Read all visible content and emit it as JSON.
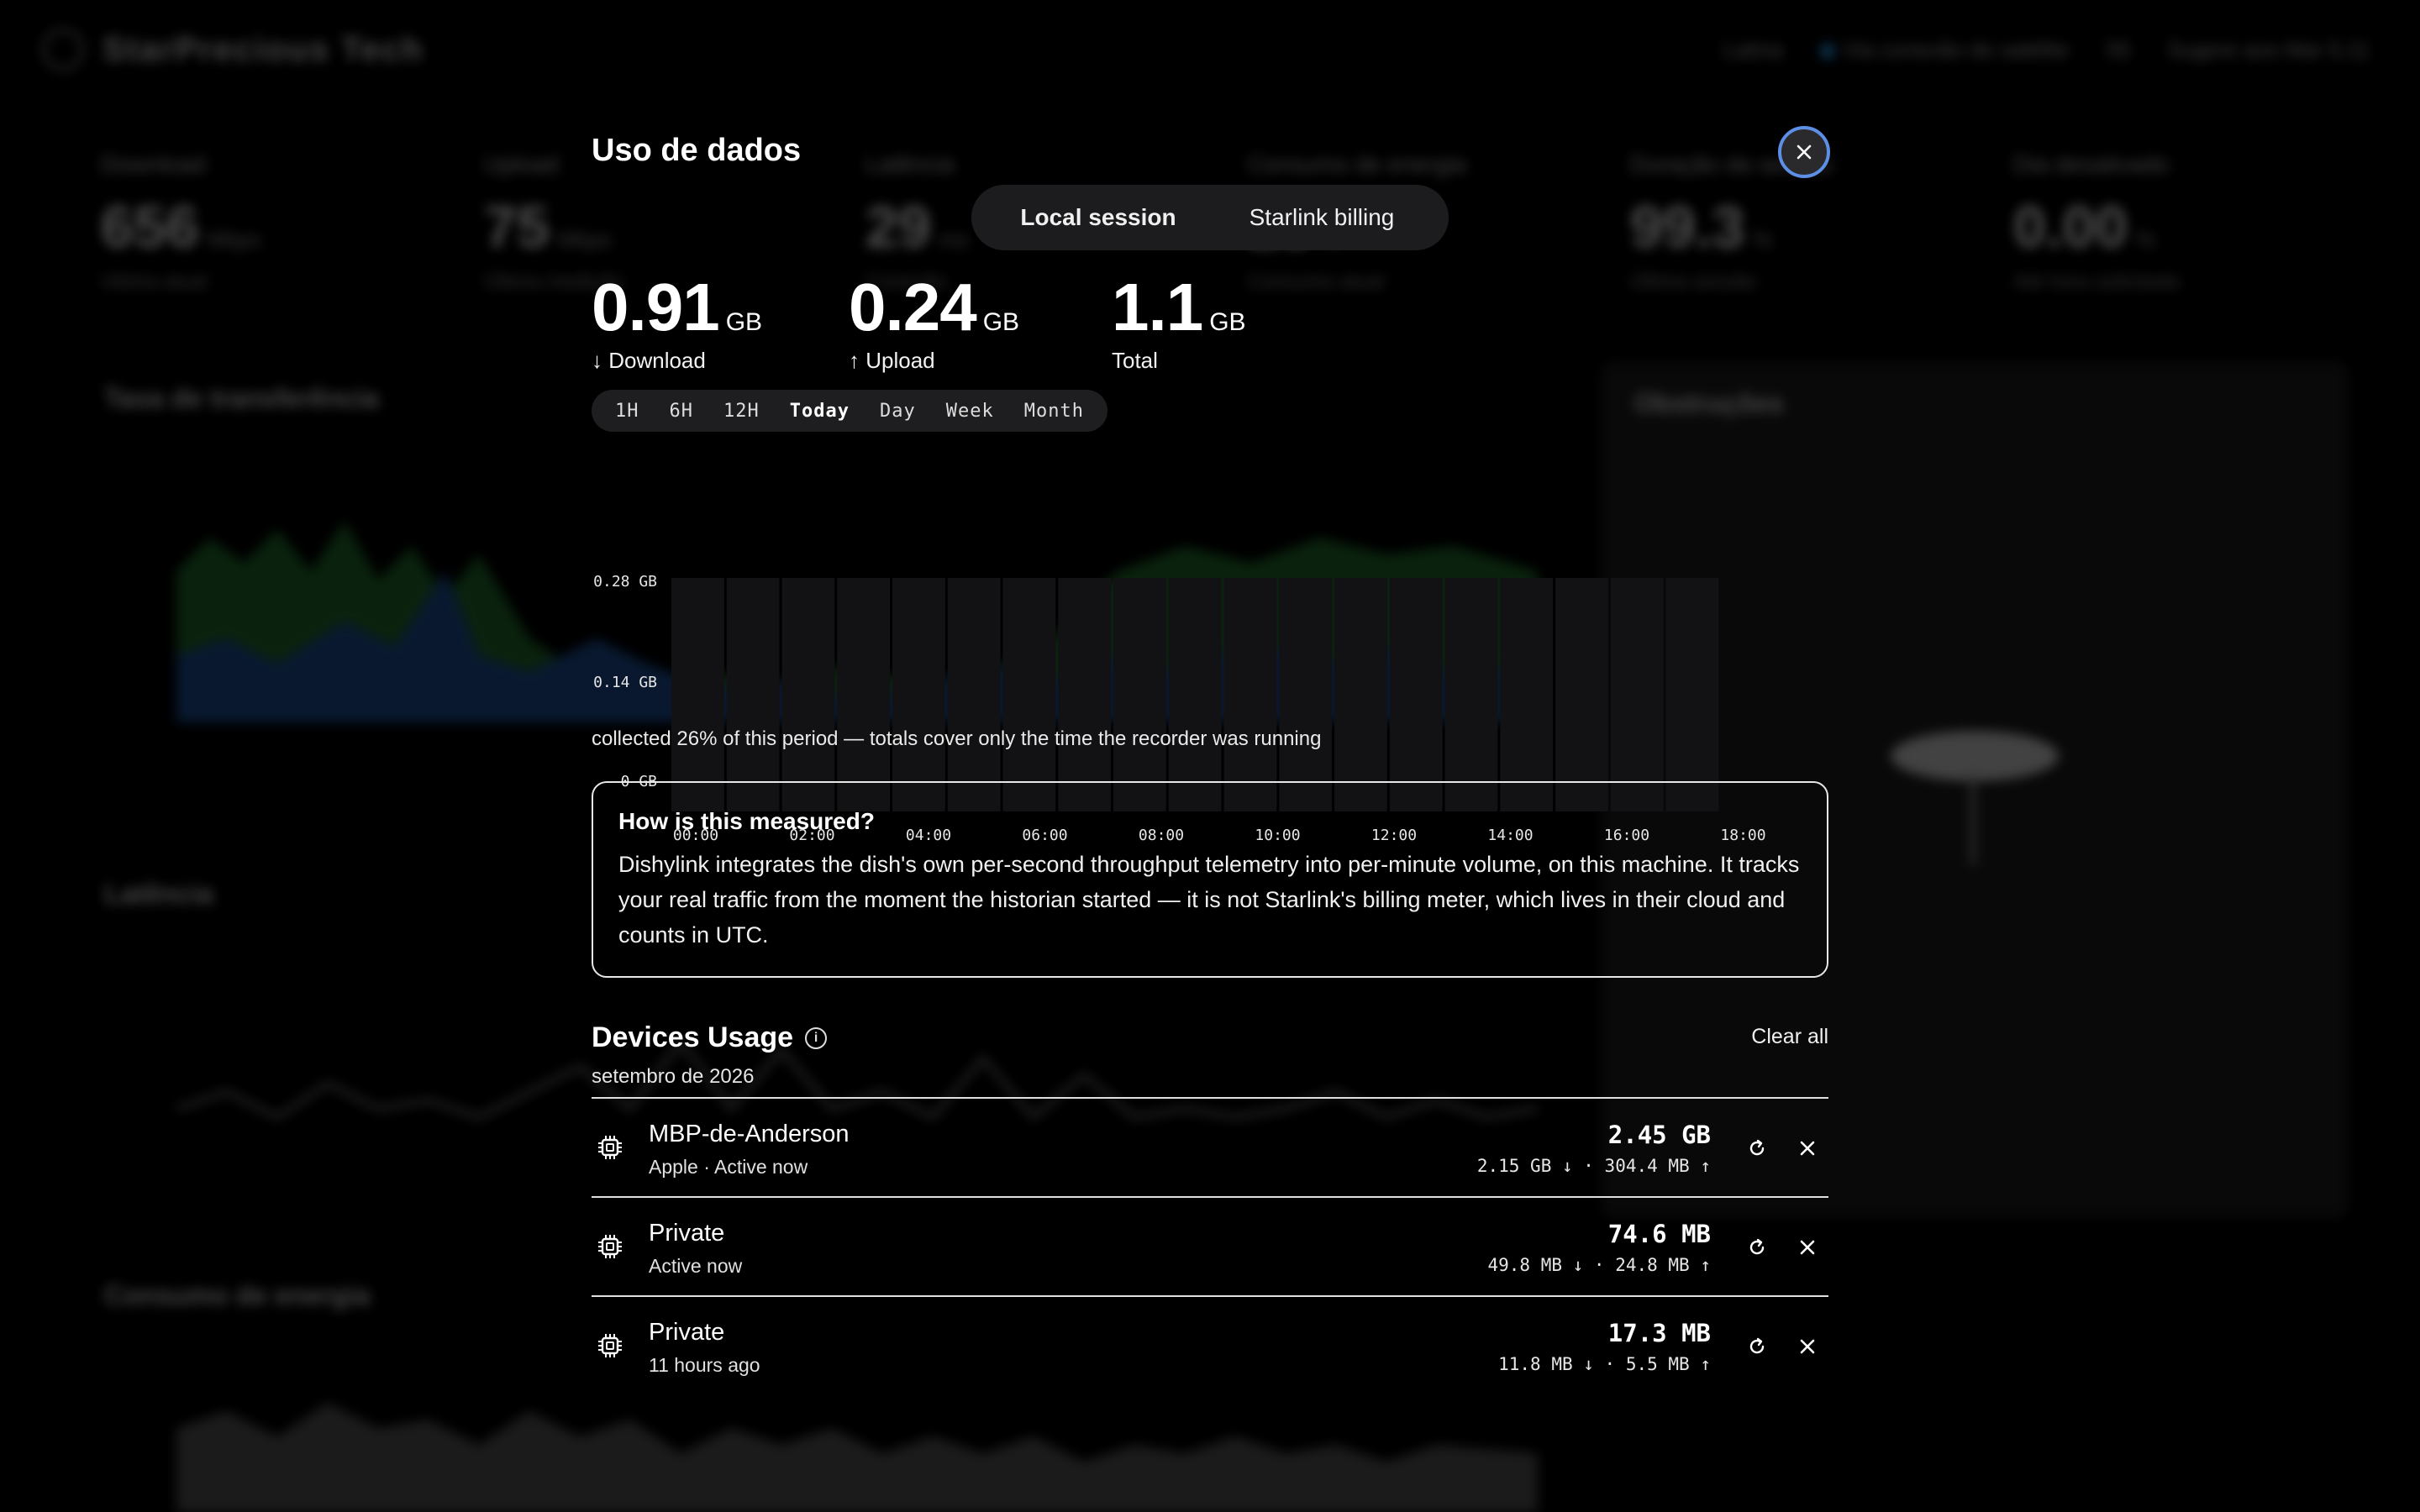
{
  "background": {
    "brand": "StarPrecious Tech",
    "nav": [
      "Latina",
      "Via conexão de satélite",
      "55",
      "Sugere aos Mar 5.11"
    ],
    "stats": [
      {
        "label": "Download",
        "value": "656",
        "unit": "Mbps",
        "sub": "Vitória atual"
      },
      {
        "label": "Upload",
        "value": "75",
        "unit": "Mbps",
        "sub": "Última medição"
      },
      {
        "label": "Latência",
        "value": "29",
        "unit": "ms",
        "sub": "Conexão"
      },
      {
        "label": "Consumo de energia",
        "value": "29",
        "unit": "W",
        "sub": "Consumo atual"
      },
      {
        "label": "Duração da sessão",
        "value": "99.3",
        "unit": "%",
        "sub": "Última sessão"
      },
      {
        "label": "Dia desativado",
        "value": "0.00",
        "unit": "%",
        "sub": "Até hora solicitada"
      }
    ],
    "panels": [
      "Taxa de transferência",
      "Latência",
      "Consumo de energia",
      "Obstruções"
    ]
  },
  "modal": {
    "title": "Uso de dados",
    "close_icon": "close-icon",
    "tabs": [
      {
        "label": "Local session",
        "active": true
      },
      {
        "label": "Starlink billing",
        "active": false
      }
    ],
    "totals": [
      {
        "value": "0.91",
        "unit": "GB",
        "caption": "↓ Download"
      },
      {
        "value": "0.24",
        "unit": "GB",
        "caption": "↑ Upload"
      },
      {
        "value": "1.1",
        "unit": "GB",
        "caption": "Total"
      }
    ],
    "ranges": [
      {
        "label": "1H",
        "active": false
      },
      {
        "label": "6H",
        "active": false
      },
      {
        "label": "12H",
        "active": false
      },
      {
        "label": "Today",
        "active": true
      },
      {
        "label": "Day",
        "active": false
      },
      {
        "label": "Week",
        "active": false
      },
      {
        "label": "Month",
        "active": false
      }
    ],
    "chart_data": {
      "type": "bar",
      "y_ticks": [
        "0.28 GB",
        "0.14 GB",
        "0 GB"
      ],
      "ylim": [
        0,
        0.28
      ],
      "x_ticks": [
        "00:00",
        "02:00",
        "04:00",
        "06:00",
        "08:00",
        "10:00",
        "12:00",
        "14:00",
        "16:00",
        "18:00"
      ],
      "categories": [
        "00:00",
        "01:00",
        "02:00",
        "03:00",
        "04:00",
        "05:00",
        "06:00",
        "07:00",
        "08:00",
        "09:00",
        "10:00",
        "11:00",
        "12:00",
        "13:00",
        "14:00",
        "15:00",
        "16:00",
        "17:00",
        "18:00"
      ],
      "series": [
        {
          "name": "Download",
          "values": [
            0,
            0,
            0,
            0,
            0,
            0,
            0,
            0,
            0,
            0,
            0,
            0,
            0,
            0,
            0,
            0,
            0,
            0,
            0
          ]
        },
        {
          "name": "Upload",
          "values": [
            0,
            0,
            0,
            0,
            0,
            0,
            0,
            0,
            0,
            0,
            0,
            0,
            0,
            0,
            0,
            0,
            0,
            0,
            0
          ]
        }
      ],
      "grid": true
    },
    "note": "collected 26% of this period — totals cover only the time the recorder was running",
    "info": {
      "heading": "How is this measured?",
      "body": "Dishylink integrates the dish's own per-second throughput telemetry into per-minute volume, on this machine. It tracks your real traffic from the moment the historian started — it is not Starlink's billing meter, which lives in their cloud and counts in UTC."
    },
    "devices": {
      "title": "Devices Usage",
      "month": "setembro de 2026",
      "clear_all": "Clear all",
      "items": [
        {
          "name": "MBP-de-Anderson",
          "meta": "Apple · Active now",
          "total": "2.45 GB",
          "split": "2.15 GB ↓ · 304.4 MB ↑"
        },
        {
          "name": "Private",
          "meta": "Active now",
          "total": "74.6 MB",
          "split": "49.8 MB ↓ · 24.8 MB ↑"
        },
        {
          "name": "Private",
          "meta": "11 hours ago",
          "total": "17.3 MB",
          "split": "11.8 MB ↓ · 5.5 MB ↑"
        }
      ]
    }
  }
}
